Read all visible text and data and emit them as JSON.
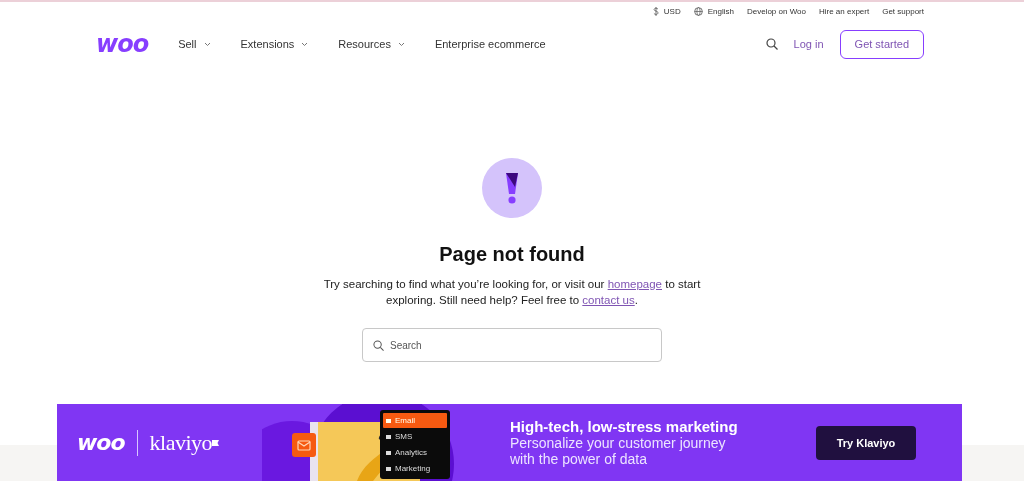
{
  "utility_bar": {
    "items": [
      {
        "kind": "currency",
        "label": "USD"
      },
      {
        "kind": "language",
        "label": "English"
      },
      {
        "kind": "link",
        "label": "Develop on Woo"
      },
      {
        "kind": "link",
        "label": "Hire an expert"
      },
      {
        "kind": "link",
        "label": "Get support"
      }
    ]
  },
  "nav": {
    "logo": "woo",
    "items": [
      {
        "label": "Sell",
        "has_menu": true
      },
      {
        "label": "Extensions",
        "has_menu": true
      },
      {
        "label": "Resources",
        "has_menu": true
      },
      {
        "label": "Enterprise ecommerce",
        "has_menu": false
      }
    ],
    "login": "Log in",
    "cta": "Get started"
  },
  "error": {
    "title": "Page not found",
    "message": [
      {
        "kind": "text",
        "text": "Try searching to find what you’re looking for, or visit our "
      },
      {
        "kind": "link",
        "text": "homepage"
      },
      {
        "kind": "text",
        "text": " to start exploring. Still need help? Feel free to "
      },
      {
        "kind": "link",
        "text": "contact us"
      },
      {
        "kind": "text",
        "text": "."
      }
    ]
  },
  "search": {
    "placeholder": "Search"
  },
  "banner": {
    "logos": [
      "woo",
      "klaviyo"
    ],
    "menu": [
      {
        "label": "Email",
        "selected": true
      },
      {
        "label": "SMS",
        "selected": false
      },
      {
        "label": "Analytics",
        "selected": false
      },
      {
        "label": "Marketing",
        "selected": false
      }
    ],
    "headline": "High-tech, low-stress marketing",
    "subline": "Personalize your customer journey\nwith the power of data",
    "button": "Try Klaviyo"
  }
}
